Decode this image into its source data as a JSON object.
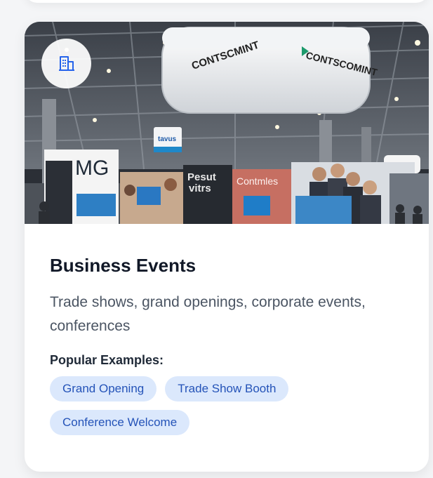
{
  "card": {
    "icon": "building-icon",
    "image_alt_signs": {
      "hanging_sign": "CONTSCOMINT",
      "booth_left": "MG",
      "booth_middle": "Contmles",
      "booth_dark": "Pesut vitrs",
      "small_sign": "tavus"
    },
    "title": "Business Events",
    "description": "Trade shows, grand openings, corporate events, conferences",
    "examples_label": "Popular Examples:",
    "examples": [
      "Grand Opening",
      "Trade Show Booth",
      "Conference Welcome"
    ]
  },
  "colors": {
    "chip_bg": "#dbe8fc",
    "chip_text": "#2453b8",
    "icon_blue": "#2563eb",
    "title": "#111827",
    "description": "#4b5563"
  }
}
